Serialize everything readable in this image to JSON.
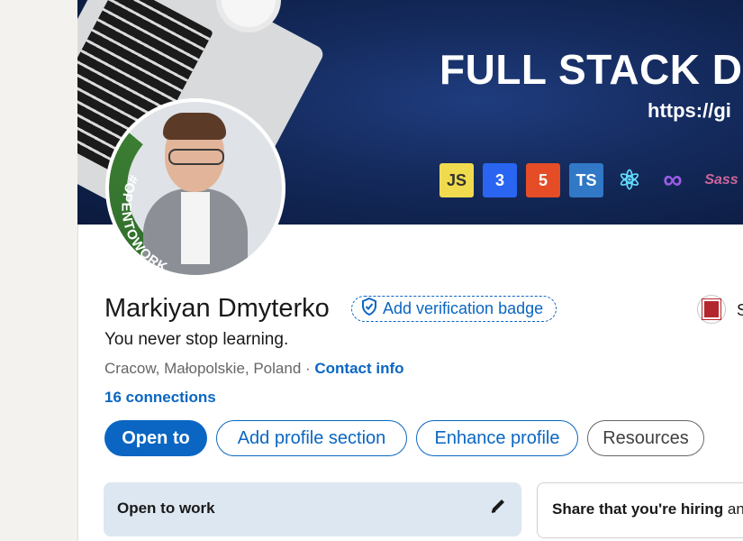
{
  "banner": {
    "title": "FULL STACK DE",
    "url": "https://gi",
    "tech_icons": [
      {
        "name": "javascript-icon",
        "label": "JS",
        "bg": "#f0db4f",
        "fg": "#323330"
      },
      {
        "name": "css3-icon",
        "label": "3",
        "bg": "#2965f1",
        "fg": "#ffffff"
      },
      {
        "name": "html5-icon",
        "label": "5",
        "bg": "#e44d26",
        "fg": "#ffffff"
      },
      {
        "name": "typescript-icon",
        "label": "TS",
        "bg": "#3178c6",
        "fg": "#ffffff"
      },
      {
        "name": "react-icon",
        "label": "⚛",
        "bg": "transparent",
        "fg": "#61dafb"
      },
      {
        "name": "redux-icon",
        "label": "∞",
        "bg": "transparent",
        "fg": "#9b5de5"
      },
      {
        "name": "sass-icon",
        "label": "Sass",
        "bg": "transparent",
        "fg": "#cc6699"
      }
    ]
  },
  "profile": {
    "open_to_work_badge": "#OPENTOWORK",
    "name": "Markiyan Dmyterko",
    "verification_label": "Add verification badge",
    "headline": "You never stop learning.",
    "location": "Cracow, Małopolskie, Poland",
    "location_separator": " · ",
    "contact_info": "Contact info",
    "connections": "16 connections",
    "company_initial": "S"
  },
  "actions": {
    "open_to": "Open to",
    "add_profile_section": "Add profile section",
    "enhance_profile": "Enhance profile",
    "resources": "Resources"
  },
  "cards": {
    "open_to_work_title": "Open to work",
    "share_hiring_bold": "Share that you're hiring",
    "share_hiring_rest": " an"
  },
  "colors": {
    "accent": "#0a66c2",
    "open_to_work_green": "#3b7d33",
    "background": "#f4f2ee"
  }
}
